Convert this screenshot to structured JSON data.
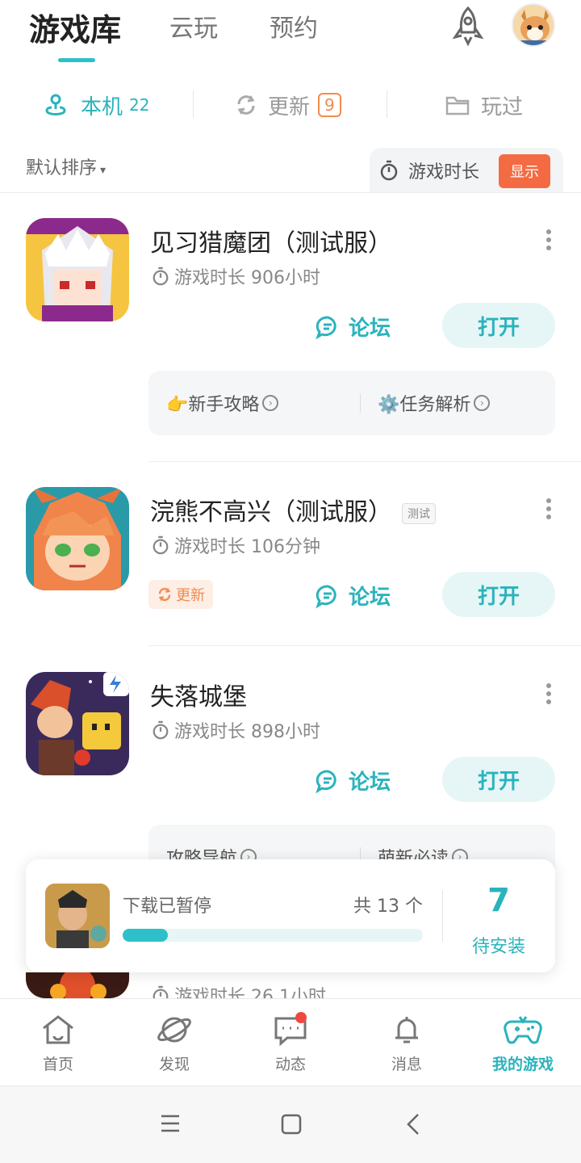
{
  "header": {
    "tabs": [
      {
        "label": "游戏库",
        "active": true
      },
      {
        "label": "云玩",
        "active": false
      },
      {
        "label": "预约",
        "active": false
      }
    ],
    "icons": [
      "rocket-icon",
      "avatar"
    ]
  },
  "sub_tabs": [
    {
      "label": "本机",
      "count": "22",
      "icon": "local-icon",
      "active": true
    },
    {
      "label": "更新",
      "badge": "9",
      "icon": "refresh-icon",
      "active": false
    },
    {
      "label": "玩过",
      "icon": "folder-icon",
      "active": false
    }
  ],
  "sort": {
    "label": "默认排序",
    "caret": "▾"
  },
  "playtime_toggle": {
    "label": "游戏时长",
    "button": "显示"
  },
  "games": [
    {
      "name": "见习猎魔团（测试服）",
      "playtime": "游戏时长 906小时",
      "forum": "论坛",
      "open": "打开",
      "guides": [
        {
          "label": "👉新手攻略"
        },
        {
          "label": "⚙️任务解析"
        }
      ]
    },
    {
      "name": "浣熊不高兴（测试服）",
      "tag": "测试",
      "playtime": "游戏时长 106分钟",
      "update": "更新",
      "forum": "论坛",
      "open": "打开"
    },
    {
      "name": "失落城堡",
      "playtime": "游戏时长 898小时",
      "forum": "论坛",
      "open": "打开",
      "guides": [
        {
          "label": "攻略导航"
        },
        {
          "label": "萌新必读"
        }
      ]
    }
  ],
  "peek": {
    "playtime": "游戏时长 26.1小时"
  },
  "download": {
    "status": "下载已暂停",
    "count": "共 13 个",
    "progress": 0.15,
    "pending_number": "7",
    "pending_label": "待安装"
  },
  "bottom_nav": [
    {
      "label": "首页",
      "icon": "home-icon"
    },
    {
      "label": "发现",
      "icon": "planet-icon"
    },
    {
      "label": "动态",
      "icon": "chat-icon",
      "dot": true
    },
    {
      "label": "消息",
      "icon": "bell-icon"
    },
    {
      "label": "我的游戏",
      "icon": "gamepad-icon",
      "active": true
    }
  ],
  "colors": {
    "accent": "#2ab3bc",
    "orange": "#f46b43",
    "badge_red": "#f0483e"
  }
}
